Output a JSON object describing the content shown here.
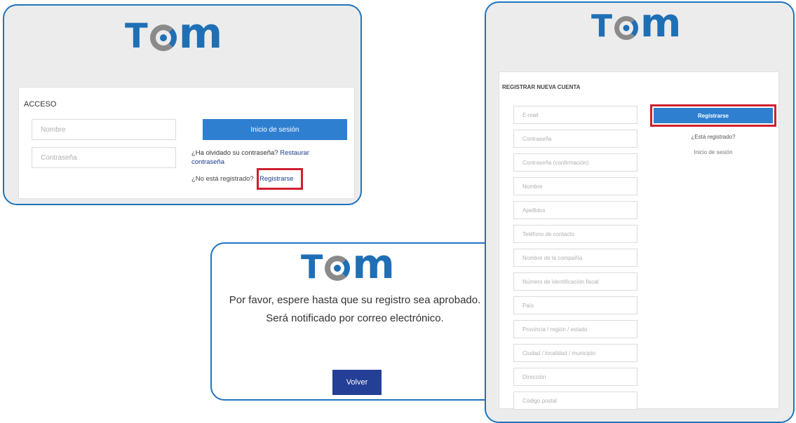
{
  "logo": {
    "t": "T",
    "m": "m"
  },
  "login": {
    "section_title": "ACCESO",
    "name_placeholder": "Nombre",
    "password_placeholder": "Contraseña",
    "login_button": "Inicio de sesión",
    "forgot_text": "¿Ha olvidado su contraseña?",
    "restore_link_1": "Restaurar",
    "restore_link_2": "contraseña",
    "not_registered": "¿No está registrado?",
    "register_link": "Registrarse"
  },
  "register": {
    "section_title": "REGISTRAR NUEVA CUENTA",
    "fields": [
      "E-mail",
      "Contraseña",
      "Contraseña (confirmación)",
      "Nombre",
      "Apellidos",
      "Teléfono de contacto",
      "Nombre de la compañía",
      "Número de identificación fiscal",
      "País",
      "Provincia / región / estado",
      "Ciudad / localidad / municipio",
      "Dirección",
      "Código postal"
    ],
    "register_button": "Registrarse",
    "already_registered": "¿Está registrado?",
    "login_link": "Inicio de sesión"
  },
  "pending": {
    "line1": "Por favor, espere hasta que su registro sea aprobado.",
    "line2": "Será notificado por correo electrónico.",
    "back_button": "Volver"
  },
  "colors": {
    "brand_blue": "#1f6fb5",
    "button_blue": "#2f7fd0",
    "dark_button": "#243f96",
    "highlight_red": "#d01f2f"
  }
}
